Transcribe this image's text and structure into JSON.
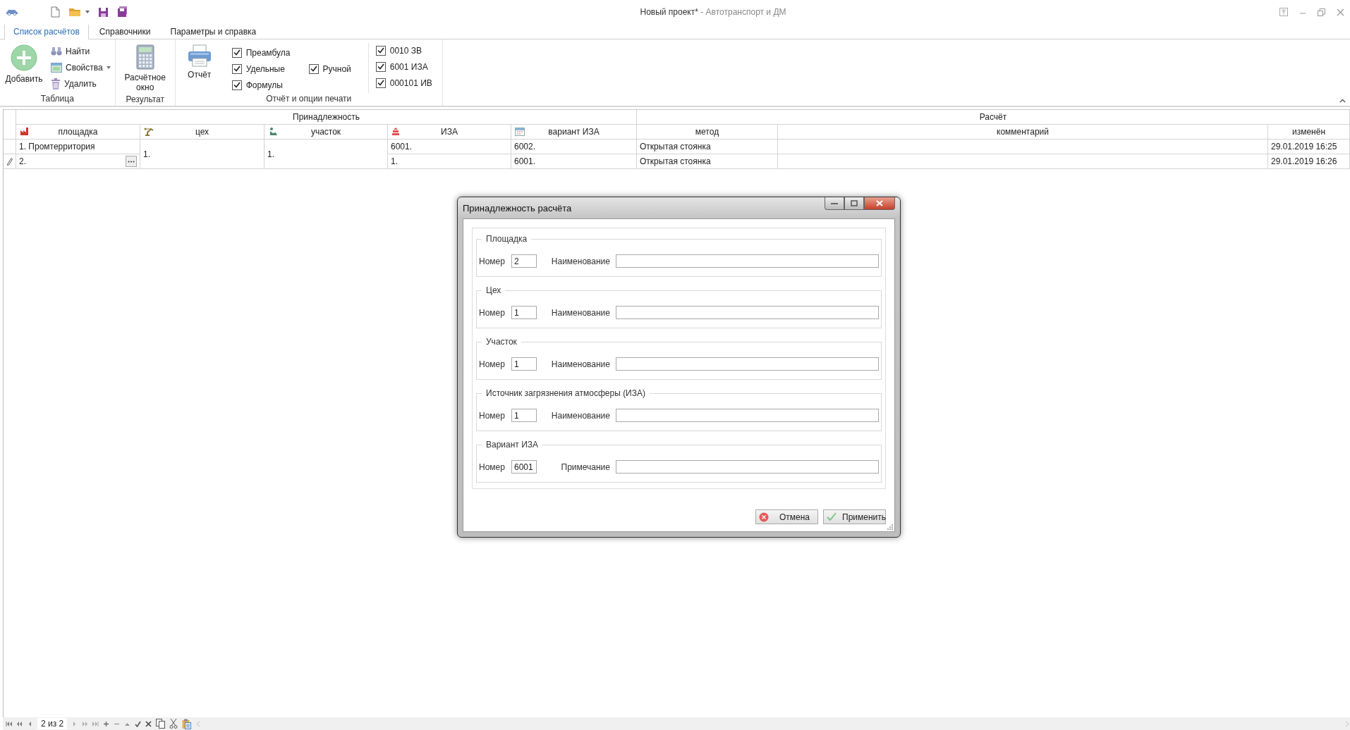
{
  "window": {
    "document": "Новый проект*",
    "app": "- Автотранспорт и ДМ"
  },
  "ribbon_tabs": [
    {
      "label": "Список расчётов",
      "selected": true
    },
    {
      "label": "Справочники",
      "selected": false
    },
    {
      "label": "Параметры и справка",
      "selected": false
    }
  ],
  "ribbon": {
    "groups": [
      {
        "label": "Таблица",
        "large": [
          {
            "label": "Добавить"
          }
        ],
        "small": [
          {
            "label": "Найти",
            "dropdown": false
          },
          {
            "label": "Свойства",
            "dropdown": true
          },
          {
            "label": "Удалить",
            "dropdown": false
          }
        ]
      },
      {
        "label": "Результат",
        "large": [
          {
            "label": "Расчётное окно"
          }
        ]
      },
      {
        "label": "Отчёт и опции печати",
        "large": [
          {
            "label": "Отчёт"
          }
        ],
        "checkbox_columns": [
          [
            {
              "label": "Преамбула",
              "checked": true
            },
            {
              "label": "Удельные",
              "checked": true
            },
            {
              "label": "Формулы",
              "checked": true
            }
          ],
          [
            {
              "label": "Ручной",
              "checked": true
            }
          ],
          [
            {
              "label": "0010 ЗВ",
              "checked": true
            },
            {
              "label": "6001 ИЗА",
              "checked": true
            },
            {
              "label": "000101 ИВ",
              "checked": true
            }
          ]
        ]
      }
    ]
  },
  "table": {
    "column_groups": [
      {
        "label": "Принадлежность",
        "columns": [
          {
            "label": "площадка"
          },
          {
            "label": "цех"
          },
          {
            "label": "участок"
          },
          {
            "label": "ИЗА"
          },
          {
            "label": "вариант ИЗА"
          }
        ]
      },
      {
        "label": "Расчёт",
        "columns": [
          {
            "label": "метод"
          },
          {
            "label": "комментарий"
          },
          {
            "label": "изменён"
          }
        ]
      }
    ],
    "rows": [
      {
        "editing": false,
        "cells": [
          {
            "text": "1. Промтерритория"
          },
          {
            "text": "1.",
            "merged_down": true
          },
          {
            "text": "1.",
            "merged_down": true
          },
          {
            "text": "6001."
          },
          {
            "text": "6002."
          },
          {
            "text": "Открытая стоянка"
          },
          null,
          {
            "text": "29.01.2019 16:25"
          }
        ]
      },
      {
        "editing": true,
        "cells": [
          {
            "text": "2."
          },
          null,
          null,
          {
            "text": "1."
          },
          {
            "text": "6001."
          },
          {
            "text": "Открытая стоянка"
          },
          null,
          {
            "text": "29.01.2019 16:26"
          }
        ]
      }
    ]
  },
  "dialog": {
    "title": "Принадлежность расчёта",
    "groups": [
      {
        "legend": "Площадка",
        "number_label": "Номер",
        "number": "2",
        "name_label": "Наименование"
      },
      {
        "legend": "Цех",
        "number_label": "Номер",
        "number": "1",
        "name_label": "Наименование"
      },
      {
        "legend": "Участок",
        "number_label": "Номер",
        "number": "1",
        "name_label": "Наименование"
      },
      {
        "legend": "Источник загрязнения атмосферы (ИЗА)",
        "number_label": "Номер",
        "number": "1",
        "name_label": "Наименование"
      },
      {
        "legend": "Вариант ИЗА",
        "number_label": "Номер",
        "number": "6001",
        "name_label": "Примечание"
      }
    ],
    "buttons": [
      {
        "label": "Отмена",
        "kind": "cancel"
      },
      {
        "label": "Применить",
        "kind": "apply"
      }
    ]
  },
  "navigator": {
    "position": "2 из 2"
  }
}
